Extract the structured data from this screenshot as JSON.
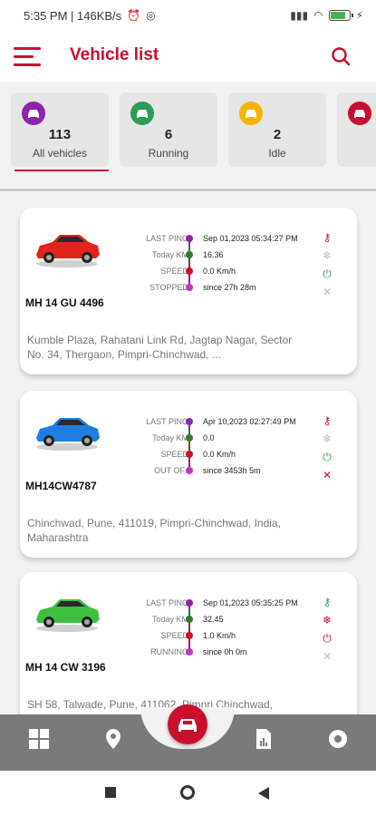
{
  "status_bar": {
    "time_speed": "5:35 PM | 146KB/s",
    "battery_percent": 80
  },
  "app_bar": {
    "title": "Vehicle list"
  },
  "summary": [
    {
      "count": "113",
      "label": "All vehicles",
      "color": "#8e24aa"
    },
    {
      "count": "6",
      "label": "Running",
      "color": "#2e9b57"
    },
    {
      "count": "2",
      "label": "Idle",
      "color": "#f5b400"
    },
    {
      "count": "",
      "label": "",
      "color": "#c8102e"
    }
  ],
  "field_labels": {
    "last_ping": "LAST PING",
    "today_km": "Today KM",
    "speed": "SPEED",
    "stopped": "STOPPED",
    "out_of": "OUT OF..",
    "running": "RUNNING"
  },
  "vehicles": [
    {
      "plate": "MH 14 GU 4496",
      "car_color": "#e0241d",
      "last_ping": "Sep 01,2023 05:34:27 PM",
      "today_km": "16.36",
      "speed": "0.0 Km/h",
      "status_label": "STOPPED",
      "status_value": "since 27h 28m",
      "address": "Kumble Plaza, Rahatani Link Rd, Jagtap Nagar, Sector No. 34, Thergaon, Pimpri-Chinchwad, ..."
    },
    {
      "plate": "MH14CW4787",
      "car_color": "#1f7fe0",
      "last_ping": "Apr 10,2023 02:27:49 PM",
      "today_km": "0.0",
      "speed": "0.0 Km/h",
      "status_label": "OUT OF..",
      "status_value": "since 3453h 5m",
      "address": "Chinchwad, Pune, 411019, Pimpri-Chinchwad, India, Maharashtra"
    },
    {
      "plate": "MH 14 CW 3196",
      "car_color": "#3fbf3f",
      "last_ping": "Sep 01,2023 05:35:25 PM",
      "today_km": "32.45",
      "speed": "1.0 Km/h",
      "status_label": "RUNNING",
      "status_value": "since 0h 0m",
      "address": "SH 58, Talwade, Pune, 411062, Pimpri Chinchwad,"
    }
  ],
  "colors": {
    "brand": "#c8102e",
    "purple": "#8e24aa",
    "green": "#2e9b57",
    "nav_bg": "#7a7a7a"
  },
  "icons": {
    "menu": "menu-icon",
    "search": "search-icon",
    "key": "key-icon",
    "ac": "ac-icon",
    "power": "power-icon",
    "gps": "gps-icon"
  }
}
